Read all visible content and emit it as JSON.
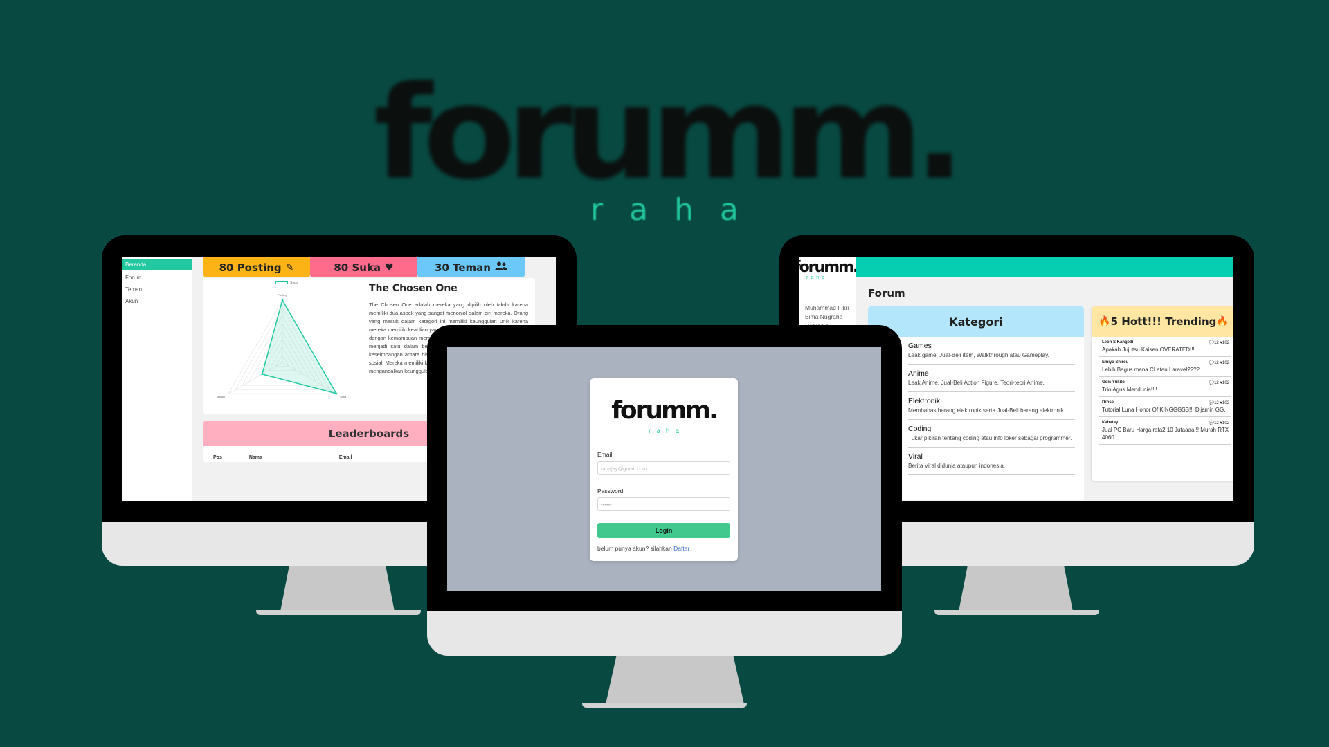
{
  "brand": {
    "wordmark": "forumm.",
    "tagline": "raha"
  },
  "colors": {
    "background": "#084a42",
    "accent": "#22c9a0",
    "topbar": "#05cfb0"
  },
  "dashboard": {
    "sidebar": [
      {
        "label": "Beranda",
        "active": true
      },
      {
        "label": "Forum"
      },
      {
        "label": "Teman"
      },
      {
        "label": "Akun"
      }
    ],
    "stats": [
      {
        "label": "80 Posting",
        "icon": "pencil-icon",
        "color": "#fbb315"
      },
      {
        "label": "80 Suka",
        "icon": "heart-icon",
        "color": "#fe6b8b"
      },
      {
        "label": "30 Teman",
        "icon": "users-icon",
        "color": "#6cc8f8"
      }
    ],
    "radar": {
      "legend": "Stats",
      "axes": [
        "Posting",
        "Suka",
        "Teman"
      ],
      "values": [
        80,
        80,
        30
      ],
      "max": 80
    },
    "title": "The Chosen One",
    "body": "The Chosen One adalah mereka yang dipilih oleh takdir karena memiliki dua aspek yang sangat menonjol dalam diri mereka. Orang yang masuk dalam kategori ini memiliki keunggulan unik karena mereka memiliki keahlian yang berbeda. Mereka bisa menyesuaikan dengan kemampuan mereka dan bisa menjadi orang yang berbeda menjadi satu dalam berbagai situasi. The Chosen One adalah keseimbangan antara bisa menonjol di dua sisi dan kreativitas dan sosial. Mereka memiliki kemampuan beradaptasi karena tidak hanya mengandalkan keunggulan yang jarang dimiliki.",
    "leaderboard": {
      "title": "Leaderboards",
      "columns": [
        "Pos",
        "Nama",
        "Email"
      ]
    }
  },
  "login": {
    "wordmark": "forumm.",
    "tagline": "raha",
    "email_label": "Email",
    "email_placeholder": "rahajay@gmail.com",
    "password_label": "Password",
    "password_placeholder": "••••••",
    "button": "Login",
    "footer_text": "belum punya akun? silahkan",
    "footer_link": "Daftar"
  },
  "forum": {
    "sidebar_logo": "forumm.",
    "sidebar_tagline": "raha",
    "users": [
      "Muhammad Fikri",
      "Bima Nugraha",
      "Rafka Fa"
    ],
    "title": "Forum",
    "kategori": {
      "title": "Kategori",
      "items": [
        {
          "name": "Games",
          "desc": "Leak game, Jual-Beli item, Walkthrough atau Gameplay."
        },
        {
          "name": "Anime",
          "desc": "Leak Anime, Jual-Beli Action Figure, Teori-teori Anime."
        },
        {
          "name": "Elektronik",
          "desc": "Membahas barang elektronik serta Jual-Beli barang elektronik"
        },
        {
          "name": "Coding",
          "desc": "Tukar pikiran tentang coding atau info loker sebagai programmer."
        },
        {
          "name": "Viral",
          "desc": "Berita Viral didunia ataupun indonesia."
        }
      ]
    },
    "trending": {
      "title": "5 Hott!!! Trending",
      "items": [
        {
          "user": "Leon S Kangedi",
          "comments": "12",
          "likes": "102",
          "text": "Apakah Jujutsu Kaisen OVERATED!!!"
        },
        {
          "user": "Emiya Shirou",
          "comments": "12",
          "likes": "102",
          "text": "Lebih Bagus mana CI atau Laravel????"
        },
        {
          "user": "Gois Yukito",
          "comments": "12",
          "likes": "102",
          "text": "Trio Agus Mendunia!!!!"
        },
        {
          "user": "Drose",
          "comments": "12",
          "likes": "102",
          "text": "Tutorial Luna Honor Of KINGGGSS!!! Dijamin GG."
        },
        {
          "user": "Kahatay",
          "comments": "12",
          "likes": "102",
          "text": "Jual PC Baru Harga rata2 10 Jutaaaa!!! Murah RTX 4060"
        }
      ]
    }
  }
}
